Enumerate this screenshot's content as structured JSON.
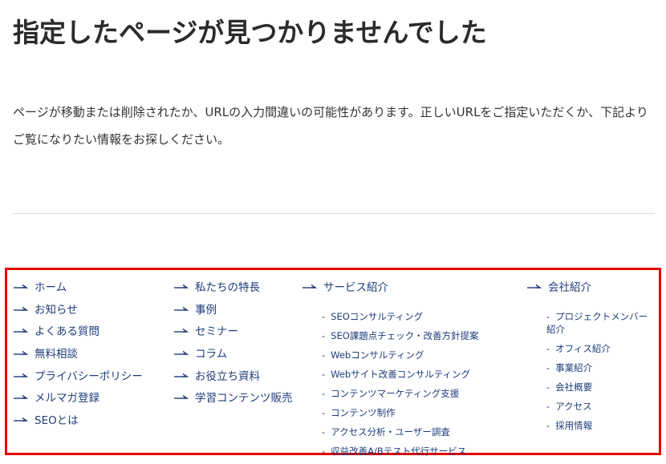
{
  "title": "指定したページが見つかりませんでした",
  "message": "ページが移動または削除されたか、URLの入力間違いの可能性があります。正しいURLをご指定いただくか、下記よりご覧になりたい情報をお探しください。",
  "sitemap": {
    "col1": [
      "ホーム",
      "お知らせ",
      "よくある質問",
      "無料相談",
      "プライバシーポリシー",
      "メルマガ登録",
      "SEOとは"
    ],
    "col2": [
      "私たちの特長",
      "事例",
      "セミナー",
      "コラム",
      "お役立ち資料",
      "学習コンテンツ販売"
    ],
    "services": {
      "label": "サービス紹介",
      "items": [
        "SEOコンサルティング",
        "SEO課題点チェック・改善方針提案",
        "Webコンサルティング",
        "Webサイト改善コンサルティング",
        "コンテンツマーケティング支援",
        "コンテンツ制作",
        "アクセス分析・ユーザー調査",
        "収益改善A/Bテスト代行サービス"
      ]
    },
    "company": {
      "label": "会社紹介",
      "items": [
        "プロジェクトメンバー紹介",
        "オフィス紹介",
        "事業紹介",
        "会社概要",
        "アクセス",
        "採用情報"
      ]
    }
  },
  "colors": {
    "link": "#1f3d7a",
    "highlight_border": "#e50000",
    "divider": "#d9d9d9"
  },
  "icons": {
    "bullet": "right-arrow-icon",
    "sub_bullet": "dash"
  }
}
